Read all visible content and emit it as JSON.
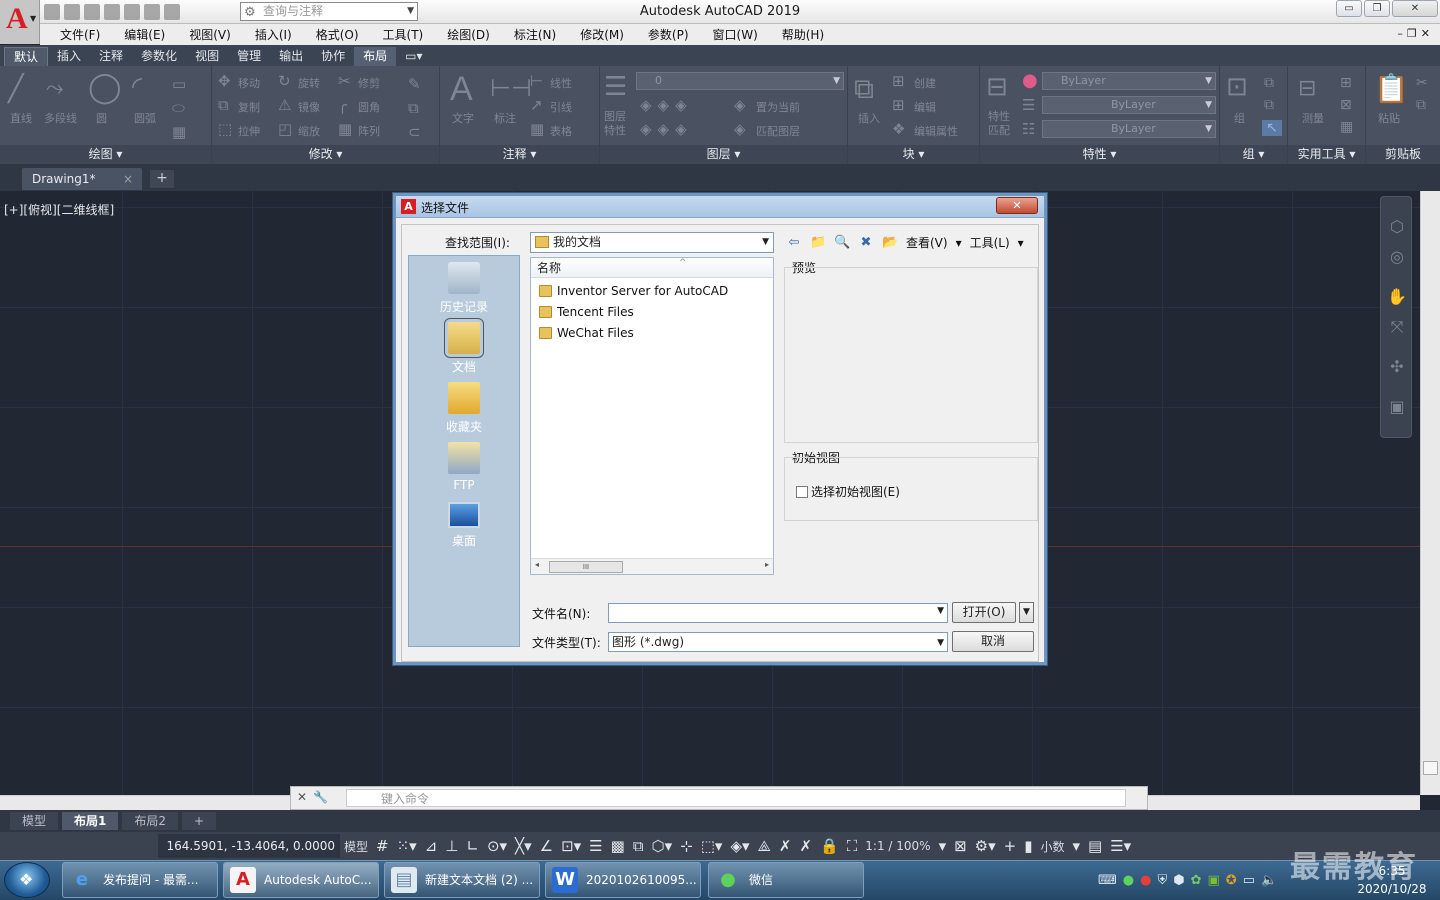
{
  "app": {
    "title": "Autodesk AutoCAD 2019",
    "workspace_placeholder": "查询与注释",
    "window_controls": {
      "minimize": "▭",
      "restore": "❐",
      "close": "✕"
    }
  },
  "menu": [
    "文件(F)",
    "编辑(E)",
    "视图(V)",
    "插入(I)",
    "格式(O)",
    "工具(T)",
    "绘图(D)",
    "标注(N)",
    "修改(M)",
    "参数(P)",
    "窗口(W)",
    "帮助(H)"
  ],
  "ribbon_tabs": [
    "默认",
    "插入",
    "注释",
    "参数化",
    "视图",
    "管理",
    "输出",
    "协作",
    "布局"
  ],
  "ribbon_panels": {
    "draw": {
      "title": "绘图 ▾",
      "tools": [
        "直线",
        "多段线",
        "圆",
        "圆弧"
      ]
    },
    "modify": {
      "title": "修改 ▾",
      "tools": [
        "移动",
        "旋转",
        "修剪",
        "复制",
        "镜像",
        "圆角",
        "拉伸",
        "缩放",
        "阵列"
      ]
    },
    "annotation": {
      "title": "注释 ▾",
      "tools": [
        "文字",
        "标注",
        "线性",
        "引线",
        "表格"
      ]
    },
    "layers": {
      "title": "图层 ▾",
      "tools": [
        "图层特性",
        "置为当前",
        "匹配图层"
      ],
      "current_layer": "0"
    },
    "block": {
      "title": "块 ▾",
      "tools": [
        "插入",
        "创建",
        "编辑",
        "编辑属性"
      ]
    },
    "properties": {
      "title": "特性 ▾",
      "tools": [
        "特性匹配"
      ],
      "values": [
        "ByLayer",
        "ByLayer",
        "ByLayer"
      ]
    },
    "groups": {
      "title": "组 ▾",
      "tools": [
        "组"
      ]
    },
    "utilities": {
      "title": "实用工具 ▾",
      "tools": [
        "测量"
      ]
    },
    "clipboard": {
      "title": "剪贴板",
      "tools": [
        "粘贴"
      ]
    }
  },
  "file_tabs": {
    "document": "Drawing1*",
    "close": "×",
    "new": "+"
  },
  "viewport_label": "[+][俯视][二维线框]",
  "dialog": {
    "title": "选择文件",
    "close": "✕",
    "look_in_label": "查找范围(I):",
    "look_in_value": "我的文档",
    "toolbar": {
      "view_label": "查看(V)",
      "tools_label": "工具(L)"
    },
    "places": [
      "历史记录",
      "文档",
      "收藏夹",
      "FTP",
      "桌面"
    ],
    "list_header": "名称",
    "files": [
      "Inventor Server for AutoCAD",
      "Tencent Files",
      "WeChat Files"
    ],
    "scroll_thumb": "III",
    "preview_label": "预览",
    "initial_view_label": "初始视图",
    "select_initial_view": "选择初始视图(E)",
    "filename_label": "文件名(N):",
    "filename_value": "",
    "filetype_label": "文件类型(T):",
    "filetype_value": "图形 (*.dwg)",
    "open_button": "打开(O)",
    "cancel_button": "取消"
  },
  "command_line": {
    "placeholder": "键入命令"
  },
  "layout_tabs": [
    "模型",
    "布局1",
    "布局2"
  ],
  "layout_new": "+",
  "status": {
    "coords": "164.5901, -13.4064, 0.0000",
    "model": "模型",
    "scale": "1:1 / 100%",
    "units": "小数"
  },
  "taskbar": {
    "items": [
      "发布提问 - 最需...",
      "Autodesk AutoC...",
      "新建文本文档 (2) ...",
      "2020102610095...",
      "微信"
    ],
    "time": "6:35",
    "date": "2020/10/28"
  },
  "watermark": "最需教育"
}
